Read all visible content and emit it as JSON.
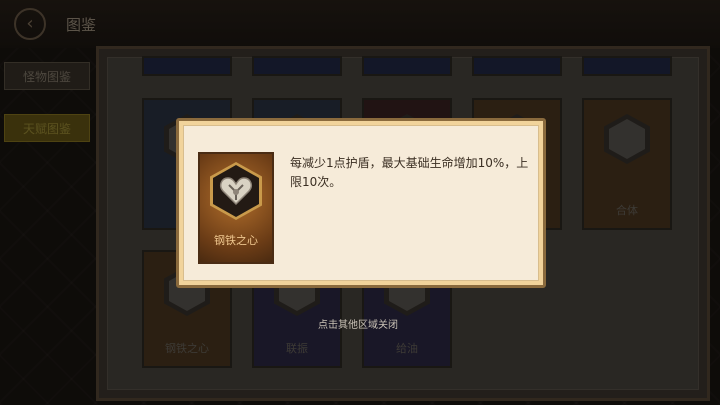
{
  "header": {
    "title": "图鉴"
  },
  "sidebar": {
    "tabs": [
      {
        "label": "怪物图鉴"
      },
      {
        "label": "天赋图鉴"
      }
    ]
  },
  "grid": {
    "row2": [
      {
        "label": ""
      },
      {
        "label": ""
      },
      {
        "label": ""
      },
      {
        "label": ""
      },
      {
        "label": "合体"
      }
    ],
    "row3": [
      {
        "label": "钢铁之心"
      },
      {
        "label": "联振"
      },
      {
        "label": "给油"
      }
    ]
  },
  "tooltip": {
    "card_label": "钢铁之心",
    "description": "每减少1点护盾，最大基础生命增加10%，上限10次。"
  },
  "close_hint": "点击其他区域关闭",
  "colors": {
    "accent": "#f1d39b",
    "tooltip_bg": "#f6ebd9",
    "selected_tab": "#6a5a17"
  }
}
